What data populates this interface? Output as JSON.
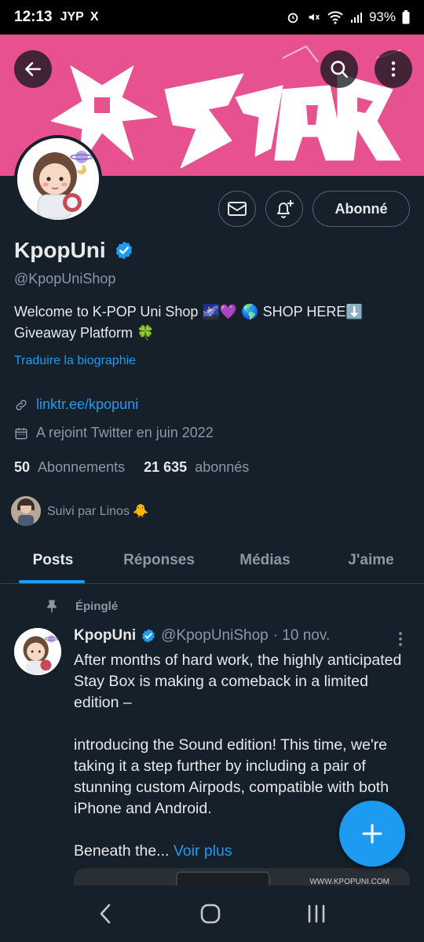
{
  "status_bar": {
    "time": "12:13",
    "left_icons": [
      "JYP",
      "X"
    ],
    "battery": "93%"
  },
  "banner": {
    "text": "樂-STAR",
    "color": "#e8518f"
  },
  "profile": {
    "name": "KpopUni",
    "handle": "@KpopUniShop",
    "bio_line1": "Welcome to K-POP Uni Shop 🌌💜 🌎 SHOP HERE⬇️",
    "bio_line2": "Giveaway Platform 🍀",
    "translate_label": "Traduire la biographie",
    "link": "linktr.ee/kpopuni",
    "joined": "A rejoint Twitter en juin 2022",
    "following_count": "50",
    "following_label": "Abonnements",
    "followers_count": "21 635",
    "followers_label": "abonnés",
    "followed_by": "Suivi par Linos 🐥",
    "follow_button": "Abonné"
  },
  "tabs": [
    "Posts",
    "Réponses",
    "Médias",
    "J'aime"
  ],
  "pinned_tweet": {
    "pinned_label": "Épinglé",
    "author": "KpopUni",
    "handle": "@KpopUniShop",
    "date": "· 10 nov.",
    "text": "After months of hard work, the highly anticipated Stay Box is making a comeback in a limited edition –\n\nintroducing the Sound edition! This time, we're taking it a step further by including a pair of stunning custom Airpods, compatible with both iPhone and Android.\n\nBeneath the... ",
    "more_label": "Voir plus",
    "media_watermark": "WWW.KPOPUNI.COM"
  },
  "colors": {
    "accent": "#1d9bf0",
    "background": "#15202b",
    "muted": "#8b98a5"
  },
  "icons": {
    "back": "arrow-left-icon",
    "search": "search-icon",
    "more": "more-vertical-icon",
    "message": "envelope-icon",
    "notify": "bell-plus-icon",
    "verified": "verified-badge-icon",
    "link": "link-icon",
    "calendar": "calendar-icon",
    "pin": "pin-icon",
    "compose": "plus-icon"
  }
}
